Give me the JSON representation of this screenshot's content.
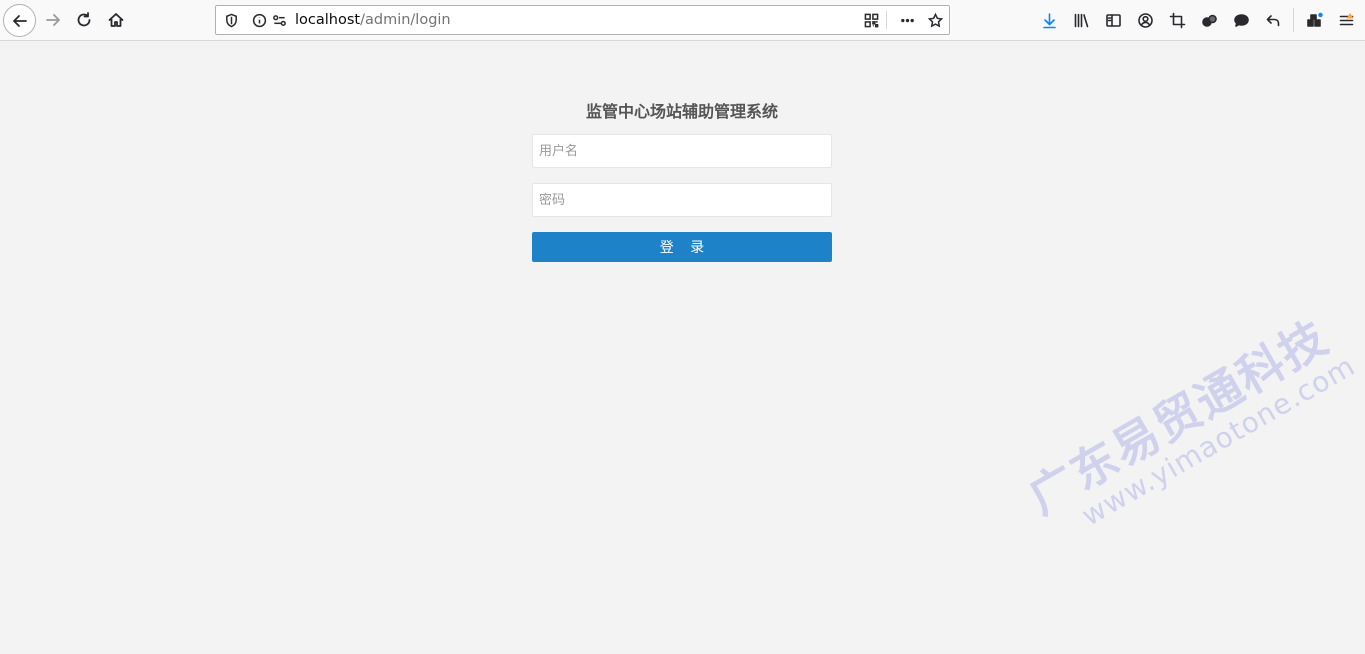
{
  "browser": {
    "url_host": "localhost",
    "url_path": "/admin/login"
  },
  "login": {
    "title": "监管中心场站辅助管理系统",
    "username_placeholder": "用户名",
    "password_placeholder": "密码",
    "submit_label": "登 录"
  },
  "watermark": {
    "company": "广东易贸通科技",
    "site": "www.yimaotone.com"
  },
  "colors": {
    "accent": "#1e82c8",
    "download_icon": "#0a84ff",
    "page_background": "#f3f3f3"
  }
}
